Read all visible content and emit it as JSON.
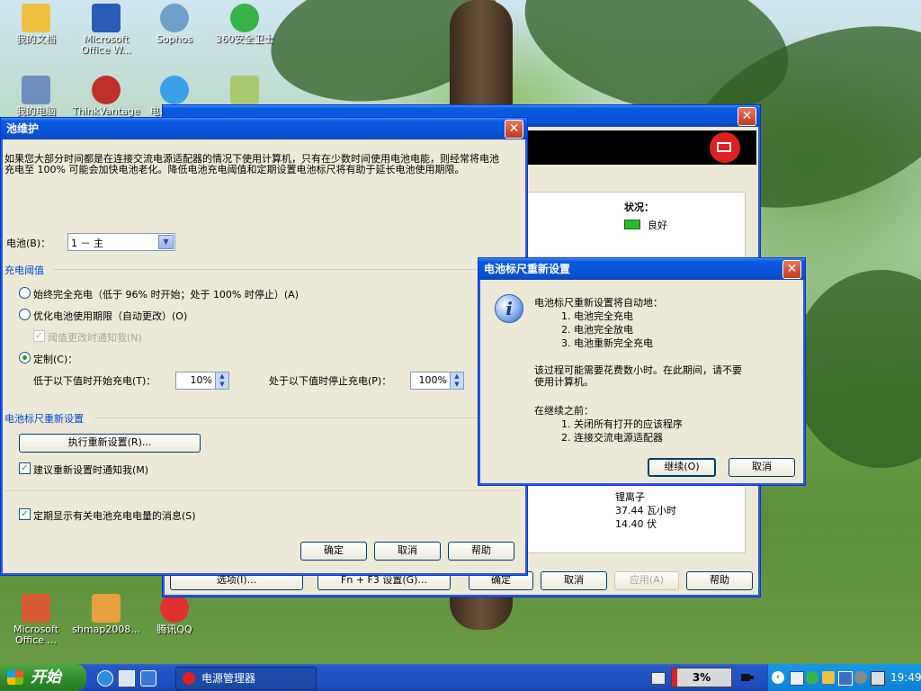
{
  "desktop": {
    "icons_top": [
      {
        "label": "我的文档",
        "color": "#f0c040"
      },
      {
        "label": "Microsoft Office W...",
        "color": "#2a5bb5"
      },
      {
        "label": "Sophos",
        "color": "#6fa0c8"
      },
      {
        "label": "360安全卫士",
        "color": "#37b34a"
      },
      {
        "label": "我的电脑",
        "color": "#6e8fbf"
      },
      {
        "label": "ThinkVantage Wi...",
        "color": "#c0302a"
      },
      {
        "label": "电源管理器",
        "color": "#3aa0e8"
      },
      {
        "label": "",
        "color": "#a8c870"
      }
    ],
    "icons_bottom": [
      {
        "label": "Microsoft Office ...",
        "color": "#d75a30"
      },
      {
        "label": "shmap2008...",
        "color": "#e8a040"
      },
      {
        "label": "腾讯QQ",
        "color": "#e03030"
      }
    ]
  },
  "bg_window": {
    "status_label": "状况：",
    "status_value": "良好",
    "rows": [
      "锂离子",
      "37.44 瓦小时",
      "14.40 伏"
    ],
    "footer_buttons": {
      "options": "选项(I)...",
      "fn_f3": "Fn + F3 设置(G)...",
      "ok": "确定",
      "cancel": "取消",
      "apply": "应用(A)",
      "help": "帮助"
    }
  },
  "battery_window": {
    "title": "池维护",
    "intro": "如果您大部分时间都是在连接交流电源适配器的情况下使用计算机，只有在少数时间使用电池电能，则经常将电池充电至 100% 可能会加快电池老化。降低电池充电阈值和定期设置电池标尺将有助于延长电池使用期限。",
    "battery_label": "电池(B)：",
    "battery_value": "1 － 主",
    "charge_threshold_group": "充电阈值",
    "radio_full": "始终完全充电（低于 96% 时开始；处于 100% 时停止）(A)",
    "radio_optimize": "优化电池使用期限（自动更改）(O)",
    "check_notify_threshold": "阈值更改时通知我(N)",
    "radio_custom": "定制(C)：",
    "start_below_label": "低于以下值时开始充电(T)：",
    "start_below_value": "10%",
    "stop_above_label": "处于以下值时停止充电(P)：",
    "stop_above_value": "100%",
    "gauge_reset_group": "电池标尺重新设置",
    "run_reset_button": "执行重新设置(R)...",
    "check_notify_reset": "建议重新设置时通知我(M)",
    "check_periodic": "定期显示有关电池充电电量的消息(S)",
    "ok": "确定",
    "cancel": "取消",
    "help": "帮助"
  },
  "dialog": {
    "title": "电池标尺重新设置",
    "line_intro": "电池标尺重新设置将自动地：",
    "steps": [
      "1.  电池完全充电",
      "2.  电池完全放电",
      "3.  电池重新完全充电"
    ],
    "warning_1": "该过程可能需要花费数小时。在此期间，请不要",
    "warning_2": "使用计算机。",
    "before_label": "在继续之前：",
    "before_steps": [
      "1.  关闭所有打开的应该程序",
      "2.  连接交流电源适配器"
    ],
    "continue": "继续(O)",
    "cancel": "取消"
  },
  "taskbar": {
    "start": "开始",
    "task": "电源管理器",
    "battery_percent": "3%",
    "time": "19:49"
  }
}
